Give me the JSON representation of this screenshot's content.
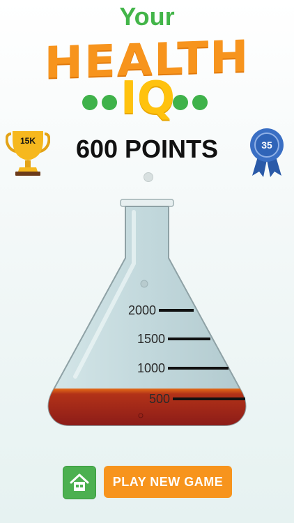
{
  "logo": {
    "line1": "Your",
    "line2": "HEALTH",
    "line3": "IQ"
  },
  "score": {
    "points_label": "600 POINTS",
    "trophy_badge": "15K",
    "ribbon_badge": "35"
  },
  "flask": {
    "marks": [
      "2000",
      "1500",
      "1000",
      "500"
    ],
    "fill_level_points": 600,
    "liquid_color": "#a0241a"
  },
  "actions": {
    "home_icon": "home-icon",
    "play_label": "PLAY NEW GAME"
  },
  "colors": {
    "green": "#43b549",
    "orange": "#f7941d",
    "yellow": "#ffc20e",
    "ribbon_blue": "#2f64b8"
  }
}
